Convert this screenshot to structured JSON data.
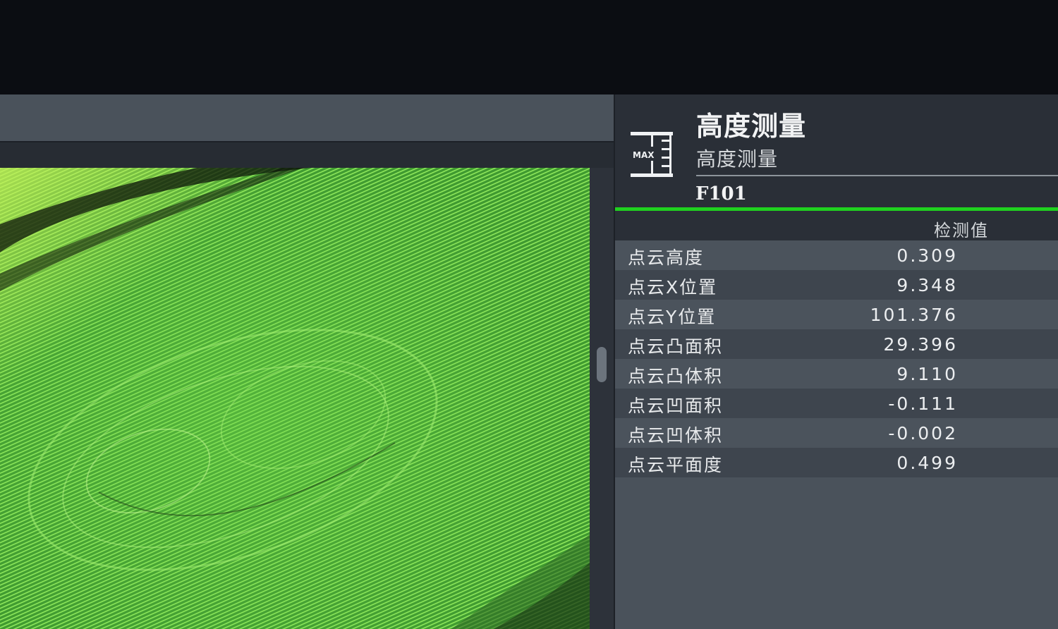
{
  "panel": {
    "icon": "max-height-measure-icon",
    "icon_text": "MAX",
    "title": "高度测量",
    "subtitle": "高度测量",
    "tool_id": "F101",
    "accent_color": "#1fd11f",
    "column_header": "检测值",
    "rows": [
      {
        "label": "点云高度",
        "value": "0.309"
      },
      {
        "label": "点云X位置",
        "value": "9.348"
      },
      {
        "label": "点云Y位置",
        "value": "101.376"
      },
      {
        "label": "点云凸面积",
        "value": "29.396"
      },
      {
        "label": "点云凸体积",
        "value": "9.110"
      },
      {
        "label": "点云凹面积",
        "value": "-0.111"
      },
      {
        "label": "点云凹体积",
        "value": "-0.002"
      },
      {
        "label": "点云平面度",
        "value": "0.499"
      }
    ]
  },
  "viewport": {
    "content": "point-cloud-height-map",
    "base_color": "#4fb83c",
    "highlight_color": "#9cf06a"
  }
}
